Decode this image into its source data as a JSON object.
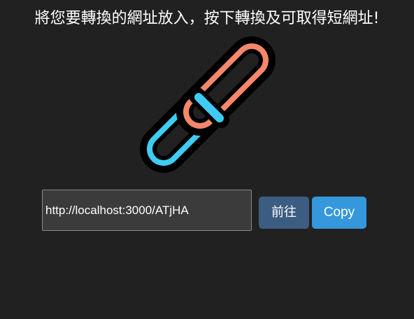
{
  "heading": "將您要轉換的網址放入，按下轉換及可取得短網址!",
  "logo": {
    "icon": "chain-link-icon",
    "colors": {
      "link_top": "#f5876b",
      "link_bottom": "#3ecdf2",
      "outline": "#000000"
    }
  },
  "short_url": {
    "value": "http://localhost:3000/ATjHA"
  },
  "buttons": {
    "go_label": "前往",
    "copy_label": "Copy"
  },
  "colors": {
    "background": "#212121",
    "go_button": "#3c5d82",
    "copy_button": "#3598dc"
  }
}
